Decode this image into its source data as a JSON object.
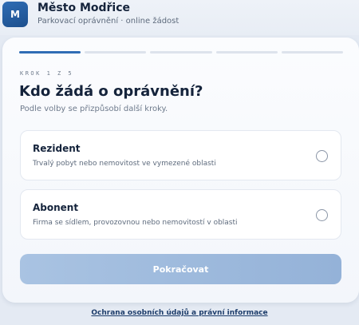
{
  "header": {
    "logo_letter": "M",
    "title": "Město Modřice",
    "subtitle": "Parkovací oprávnění · online žádost"
  },
  "progress": {
    "total_steps": 5,
    "current_step": 1,
    "step_label": "KROK 1 Z 5"
  },
  "form": {
    "question": "Kdo žádá o oprávnění?",
    "hint": "Podle volby se přizpůsobí další kroky.",
    "options": [
      {
        "title": "Rezident",
        "description": "Trvalý pobyt nebo nemovitost ve vymezené oblasti",
        "selected": false
      },
      {
        "title": "Abonent",
        "description": "Firma se sídlem, provozovnou nebo nemovitostí v oblasti",
        "selected": false
      }
    ],
    "continue_label": "Pokračovat",
    "continue_enabled": false
  },
  "footer": {
    "link_label": "Ochrana osobních údajů a právní informace"
  },
  "colors": {
    "brand": "#2f6db5",
    "text_primary": "#14233b",
    "button_disabled": "#a9c3e2"
  },
  "icons": {
    "radio": "radio-unchecked-icon"
  }
}
